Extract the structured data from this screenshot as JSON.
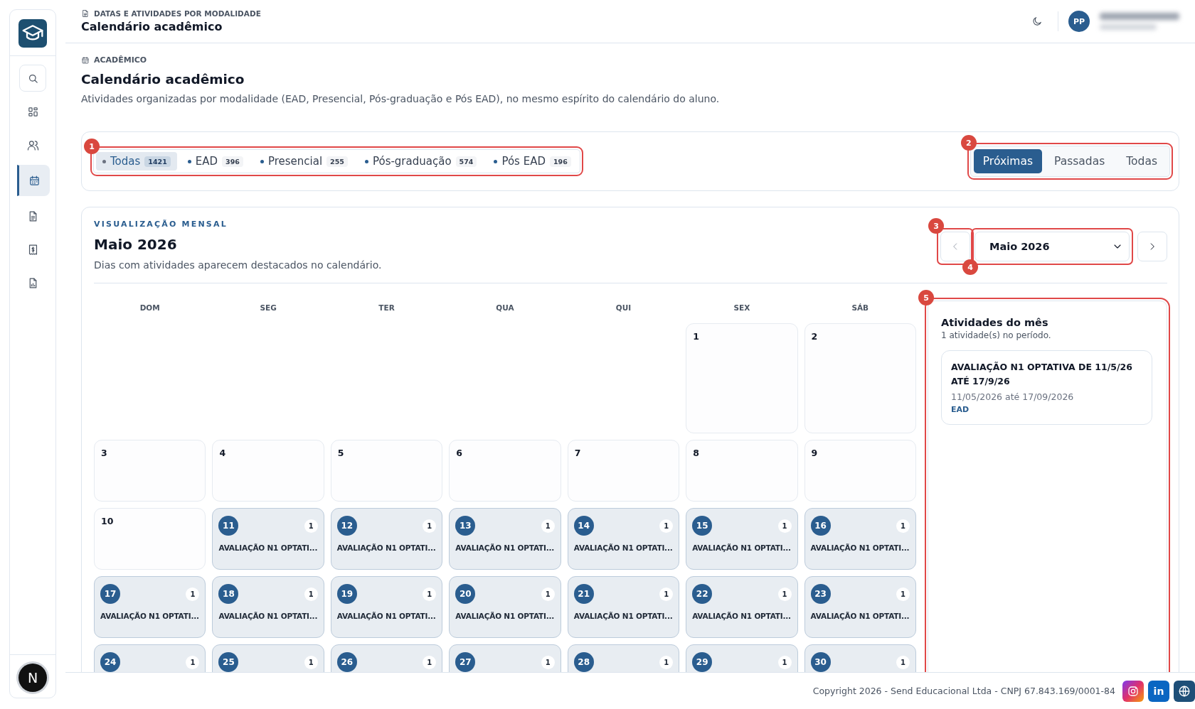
{
  "sidebar": {
    "logo": {
      "kind": "graduation"
    },
    "items": [
      {
        "kind": "search",
        "selected": false
      },
      {
        "kind": "grid",
        "selected": false
      },
      {
        "kind": "users",
        "selected": false
      },
      {
        "kind": "calendar",
        "selected": true
      },
      {
        "kind": "document",
        "selected": false
      },
      {
        "kind": "money",
        "selected": false
      },
      {
        "kind": "report",
        "selected": false
      }
    ],
    "avatar": "N"
  },
  "header": {
    "breadcrumb": "DATAS E ATIVIDADES POR MODALIDADE",
    "title": "Calendário acadêmico",
    "user_initials": "PP"
  },
  "page": {
    "eyebrow": "ACADÊMICO",
    "title": "Calendário acadêmico",
    "description": "Atividades organizadas por modalidade (EAD, Presencial, Pós-graduação e Pós EAD), no mesmo espírito do calendário do aluno."
  },
  "modality_filter": {
    "annotation": "1",
    "items": [
      {
        "label": "Todas",
        "count": "1421",
        "selected": true,
        "color": "#6b7280"
      },
      {
        "label": "EAD",
        "count": "396",
        "selected": false,
        "color": "#2a5d8f"
      },
      {
        "label": "Presencial",
        "count": "255",
        "selected": false,
        "color": "#2a5d8f"
      },
      {
        "label": "Pós-graduação",
        "count": "574",
        "selected": false,
        "color": "#2a5d8f"
      },
      {
        "label": "Pós EAD",
        "count": "196",
        "selected": false,
        "color": "#2a5d8f"
      }
    ]
  },
  "period_tabs": {
    "annotation": "2",
    "items": [
      {
        "label": "Próximas",
        "selected": true
      },
      {
        "label": "Passadas",
        "selected": false
      },
      {
        "label": "Todas",
        "selected": false
      }
    ]
  },
  "calendar": {
    "eyebrow": "VISUALIZAÇÃO MENSAL",
    "title": "Maio 2026",
    "description": "Dias com atividades aparecem destacados no calendário.",
    "prev_annotation": "3",
    "month_select": {
      "value": "Maio 2026",
      "annotation": "4"
    },
    "weekdays": [
      "DOM",
      "SEG",
      "TER",
      "QUA",
      "QUI",
      "SEX",
      "SÁB"
    ],
    "weeks": [
      [
        {
          "kind": "blank"
        },
        {
          "kind": "blank"
        },
        {
          "kind": "blank"
        },
        {
          "kind": "blank"
        },
        {
          "kind": "blank"
        },
        {
          "kind": "day",
          "day": "1",
          "highlighted": false
        },
        {
          "kind": "day",
          "day": "2",
          "highlighted": false
        }
      ],
      [
        {
          "kind": "day",
          "day": "3",
          "highlighted": false
        },
        {
          "kind": "day",
          "day": "4",
          "highlighted": false
        },
        {
          "kind": "day",
          "day": "5",
          "highlighted": false
        },
        {
          "kind": "day",
          "day": "6",
          "highlighted": false
        },
        {
          "kind": "day",
          "day": "7",
          "highlighted": false
        },
        {
          "kind": "day",
          "day": "8",
          "highlighted": false
        },
        {
          "kind": "day",
          "day": "9",
          "highlighted": false
        }
      ],
      [
        {
          "kind": "day",
          "day": "10",
          "highlighted": false
        },
        {
          "kind": "day",
          "day": "11",
          "highlighted": true,
          "count": "1",
          "event": "AVALIAÇÃO N1 OPTATI..."
        },
        {
          "kind": "day",
          "day": "12",
          "highlighted": true,
          "count": "1",
          "event": "AVALIAÇÃO N1 OPTATI..."
        },
        {
          "kind": "day",
          "day": "13",
          "highlighted": true,
          "count": "1",
          "event": "AVALIAÇÃO N1 OPTATI..."
        },
        {
          "kind": "day",
          "day": "14",
          "highlighted": true,
          "count": "1",
          "event": "AVALIAÇÃO N1 OPTATI..."
        },
        {
          "kind": "day",
          "day": "15",
          "highlighted": true,
          "count": "1",
          "event": "AVALIAÇÃO N1 OPTATI..."
        },
        {
          "kind": "day",
          "day": "16",
          "highlighted": true,
          "count": "1",
          "event": "AVALIAÇÃO N1 OPTATI..."
        }
      ],
      [
        {
          "kind": "day",
          "day": "17",
          "highlighted": true,
          "count": "1",
          "event": "AVALIAÇÃO N1 OPTATI..."
        },
        {
          "kind": "day",
          "day": "18",
          "highlighted": true,
          "count": "1",
          "event": "AVALIAÇÃO N1 OPTATI..."
        },
        {
          "kind": "day",
          "day": "19",
          "highlighted": true,
          "count": "1",
          "event": "AVALIAÇÃO N1 OPTATI..."
        },
        {
          "kind": "day",
          "day": "20",
          "highlighted": true,
          "count": "1",
          "event": "AVALIAÇÃO N1 OPTATI..."
        },
        {
          "kind": "day",
          "day": "21",
          "highlighted": true,
          "count": "1",
          "event": "AVALIAÇÃO N1 OPTATI..."
        },
        {
          "kind": "day",
          "day": "22",
          "highlighted": true,
          "count": "1",
          "event": "AVALIAÇÃO N1 OPTATI..."
        },
        {
          "kind": "day",
          "day": "23",
          "highlighted": true,
          "count": "1",
          "event": "AVALIAÇÃO N1 OPTATI..."
        }
      ],
      [
        {
          "kind": "day",
          "day": "24",
          "highlighted": true,
          "count": "1"
        },
        {
          "kind": "day",
          "day": "25",
          "highlighted": true,
          "count": "1"
        },
        {
          "kind": "day",
          "day": "26",
          "highlighted": true,
          "count": "1"
        },
        {
          "kind": "day",
          "day": "27",
          "highlighted": true,
          "count": "1"
        },
        {
          "kind": "day",
          "day": "28",
          "highlighted": true,
          "count": "1"
        },
        {
          "kind": "day",
          "day": "29",
          "highlighted": true,
          "count": "1"
        },
        {
          "kind": "day",
          "day": "30",
          "highlighted": true,
          "count": "1"
        }
      ]
    ],
    "activities": {
      "annotation": "5",
      "title": "Atividades do mês",
      "subtitle": "1 atividade(s) no período.",
      "items": [
        {
          "title": "AVALIAÇÃO N1 OPTATIVA DE 11/5/26 ATÉ 17/9/26",
          "dates": "11/05/2026 até 17/09/2026",
          "modality": "EAD"
        }
      ]
    }
  },
  "footer": {
    "copyright": "Copyright 2026 - Send Educacional Ltda - CNPJ 67.843.169/0001-84",
    "social": [
      {
        "kind": "instagram"
      },
      {
        "kind": "linkedin",
        "label": "in"
      },
      {
        "kind": "web"
      }
    ]
  }
}
